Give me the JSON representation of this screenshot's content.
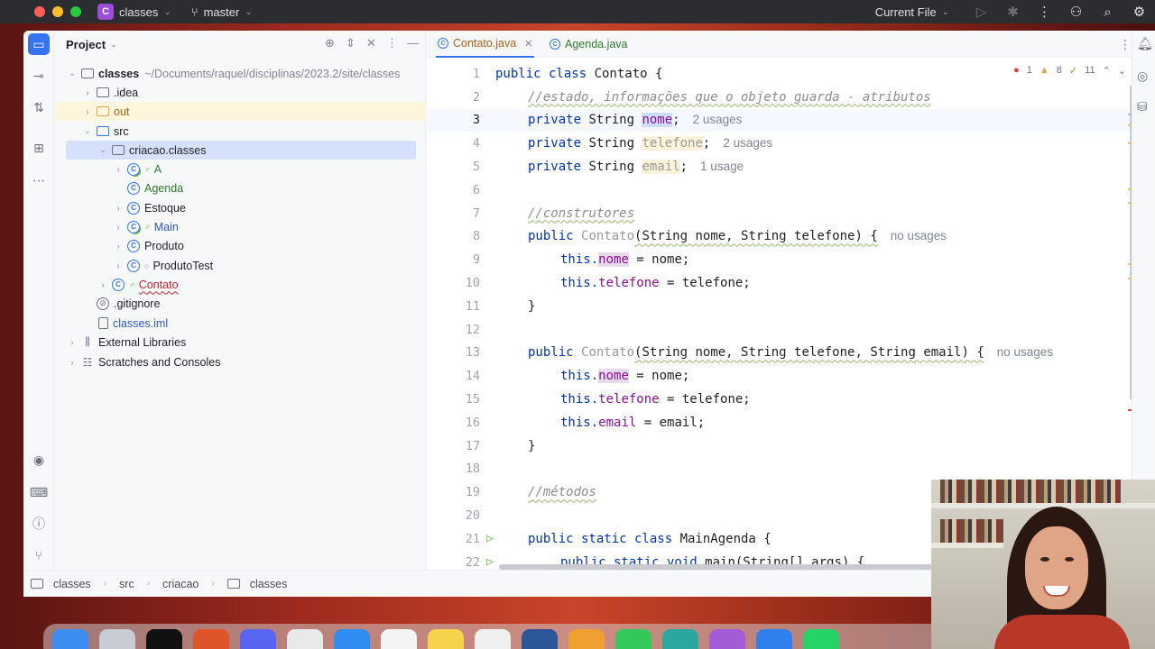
{
  "titlebar": {
    "project_badge": "C",
    "project_name": "classes",
    "branch": "master",
    "run_config": "Current File"
  },
  "project_panel": {
    "title": "Project",
    "tree": [
      {
        "label": "classes",
        "path": "~/Documents/raquel/disciplinas/2023.2/site/classes",
        "icon": "folder-icon",
        "level": 0,
        "expanded": true,
        "bold": true
      },
      {
        "label": ".idea",
        "icon": "folder-icon",
        "level": 1,
        "expanded": false
      },
      {
        "label": "out",
        "icon": "folder-icon",
        "level": 1,
        "expanded": false,
        "color": "#e7a447"
      },
      {
        "label": "src",
        "icon": "folder-icon",
        "level": 1,
        "expanded": true
      },
      {
        "label": "criacao.classes",
        "icon": "package-icon",
        "level": 2,
        "expanded": true,
        "selected": true
      },
      {
        "label": "A",
        "icon": "class-icon",
        "level": 3,
        "expanded": false,
        "color": "#2b7a2b"
      },
      {
        "label": "Agenda",
        "icon": "class-icon",
        "level": 3,
        "color": "#2b7a2b"
      },
      {
        "label": "Estoque",
        "icon": "class-icon",
        "level": 3,
        "expanded": false
      },
      {
        "label": "Main",
        "icon": "class-icon",
        "level": 3,
        "expanded": false,
        "color": "#2a56c6"
      },
      {
        "label": "Produto",
        "icon": "class-icon",
        "level": 3,
        "expanded": false
      },
      {
        "label": "ProdutoTest",
        "icon": "class-icon",
        "level": 3,
        "expanded": false
      },
      {
        "label": "Contato",
        "icon": "class-icon",
        "level": 2,
        "expanded": false,
        "color": "#c7222d"
      },
      {
        "label": ".gitignore",
        "icon": "gitignore-icon",
        "level": 1
      },
      {
        "label": "classes.iml",
        "icon": "file-icon",
        "level": 1,
        "color": "#2a56c6"
      },
      {
        "label": "External Libraries",
        "icon": "library-icon",
        "level": 0,
        "expanded": false
      },
      {
        "label": "Scratches and Consoles",
        "icon": "scratches-icon",
        "level": 0,
        "expanded": false
      }
    ]
  },
  "editor": {
    "tabs": [
      {
        "label": "Contato.java",
        "active": true
      },
      {
        "label": "Agenda.java",
        "active": false
      }
    ],
    "inspections": {
      "errors": "1",
      "warnings": "8",
      "weak_warnings": "11"
    },
    "hints": {
      "l3": "2 usages",
      "l4": "2 usages",
      "l5": "1 usage",
      "l8": "no usages",
      "l13": "no usages"
    },
    "lines": {
      "l1": "1",
      "l2": "2",
      "l3": "3",
      "l4": "4",
      "l5": "5",
      "l6": "6",
      "l7": "7",
      "l8": "8",
      "l9": "9",
      "l10": "10",
      "l11": "11",
      "l12": "12",
      "l13": "13",
      "l14": "14",
      "l15": "15",
      "l16": "16",
      "l17": "17",
      "l18": "18",
      "l19": "19",
      "l20": "20",
      "l21": "21",
      "l22": "22"
    },
    "code": {
      "l1_kw": "public class ",
      "l1_rest": "Contato {",
      "l2": "//estado, informações que o objeto guarda - atributos",
      "l3_kw": "private ",
      "l3_type": "String ",
      "l3_field": "nome",
      "l3_end": ";",
      "l4_kw": "private ",
      "l4_type": "String ",
      "l4_field": "telefone",
      "l4_end": ";",
      "l5_kw": "private ",
      "l5_type": "String ",
      "l5_field": "email",
      "l5_end": ";",
      "l7": "//construtores",
      "l8_kw": "public ",
      "l8_name": "Contato",
      "l8_rest": "(String nome, String telefone) {",
      "l9_this": "this.",
      "l9_field": "nome",
      "l9_rest": " = nome;",
      "l10_this": "this.",
      "l10_field": "telefone",
      "l10_rest": " = telefone;",
      "l11": "}",
      "l13_kw": "public ",
      "l13_name": "Contato",
      "l13_rest": "(String nome, String telefone, String email) {",
      "l14_this": "this.",
      "l14_field": "nome",
      "l14_rest": " = nome;",
      "l15_this": "this.",
      "l15_field": "telefone",
      "l15_rest": " = telefone;",
      "l16_this": "this.",
      "l16_field": "email",
      "l16_rest": " = email;",
      "l17": "}",
      "l19": "//métodos",
      "l21_kw": "public static class ",
      "l21_rest": "MainAgenda {",
      "l22_kw": "public static void ",
      "l22_rest": "main(String[] args) {"
    }
  },
  "statusbar": {
    "breadcrumbs": [
      "classes",
      "src",
      "criacao",
      "classes"
    ]
  },
  "colors": {
    "accent": "#3574f0",
    "keyword": "#0033b3",
    "field": "#871094",
    "comment": "#8c8c8c",
    "error": "#db3b3b"
  }
}
